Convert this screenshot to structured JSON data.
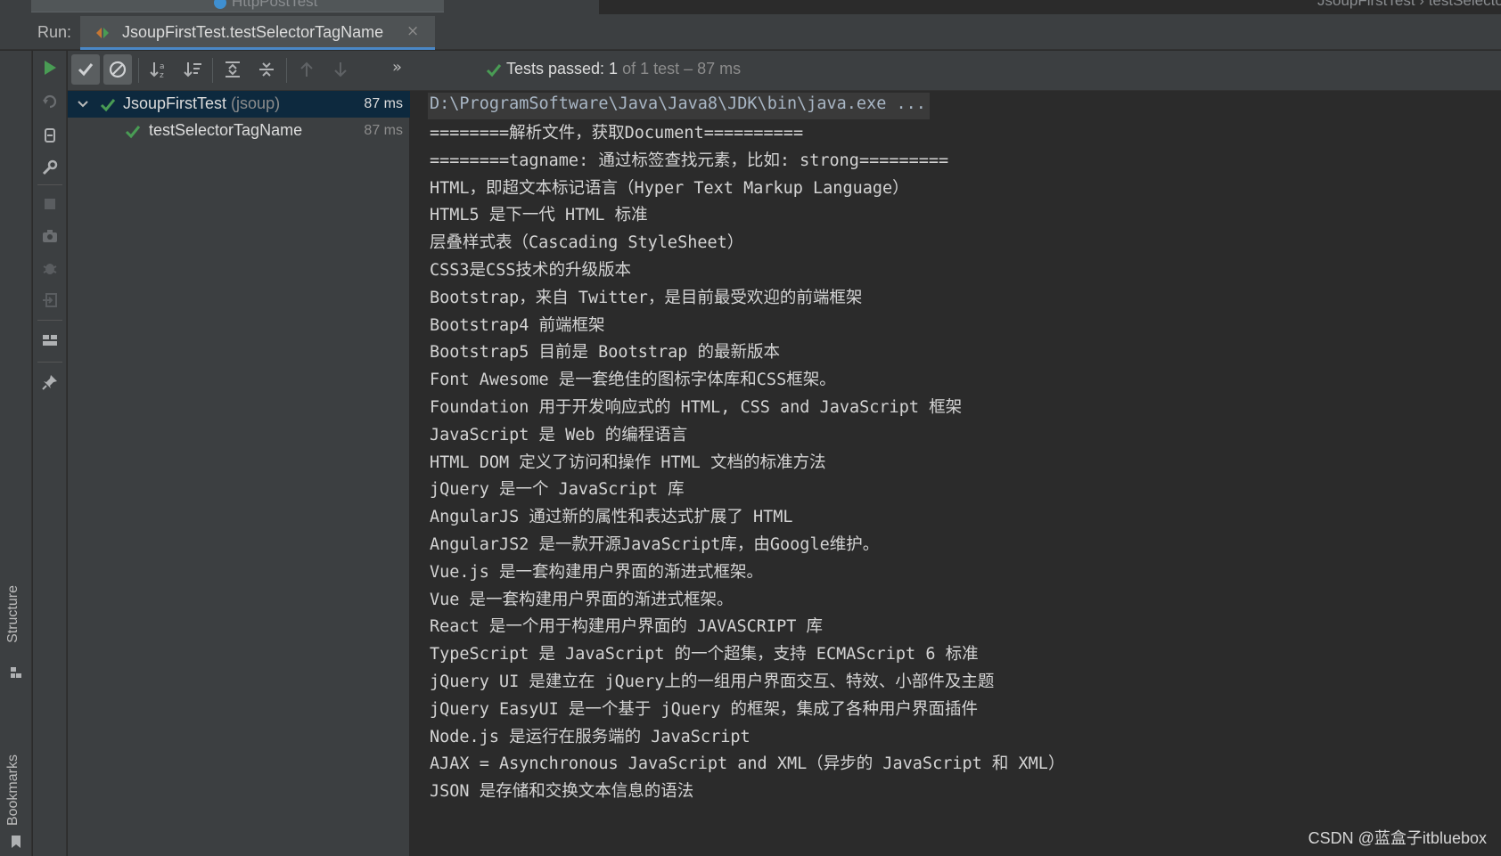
{
  "top_strip": {
    "left_tab": "HttpPostTest",
    "breadcrumb": "JsoupFirstTest  ›  testSelectorTagName()"
  },
  "run_bar": {
    "label": "Run:",
    "tab_title": "JsoupFirstTest.testSelectorTagName",
    "close_glyph": "×"
  },
  "toolbar": {
    "more_glyph": "»",
    "status_passed": "Tests passed: 1",
    "status_rest": " of 1 test – 87 ms"
  },
  "tree": {
    "root_name": "JsoupFirstTest",
    "root_pkg": " (jsoup)",
    "root_time": "87 ms",
    "child_name": "testSelectorTagName",
    "child_time": "87 ms"
  },
  "console": {
    "command": "D:\\ProgramSoftware\\Java\\Java8\\JDK\\bin\\java.exe ...",
    "lines": [
      "========解析文件，获取Document==========",
      "========tagname: 通过标签查找元素，比如: strong=========",
      "HTML，即超文本标记语言（Hyper Text Markup Language）",
      "HTML5 是下一代 HTML 标准",
      "层叠样式表（Cascading StyleSheet）",
      "CSS3是CSS技术的升级版本",
      "Bootstrap，来自 Twitter，是目前最受欢迎的前端框架",
      "Bootstrap4 前端框架",
      "Bootstrap5 目前是 Bootstrap 的最新版本",
      "Font Awesome 是一套绝佳的图标字体库和CSS框架。",
      "Foundation 用于开发响应式的 HTML, CSS and JavaScript 框架",
      "JavaScript 是 Web 的编程语言",
      "HTML DOM 定义了访问和操作 HTML 文档的标准方法",
      "jQuery 是一个 JavaScript 库",
      "AngularJS 通过新的属性和表达式扩展了 HTML",
      "AngularJS2 是一款开源JavaScript库，由Google维护。",
      "Vue.js 是一套构建用户界面的渐进式框架。",
      "Vue 是一套构建用户界面的渐进式框架。",
      "React 是一个用于构建用户界面的 JAVASCRIPT 库",
      "TypeScript 是 JavaScript 的一个超集，支持 ECMAScript 6 标准",
      "jQuery UI 是建立在 jQuery上的一组用户界面交互、特效、小部件及主题",
      "jQuery EasyUI 是一个基于 jQuery 的框架，集成了各种用户界面插件",
      "Node.js 是运行在服务端的 JavaScript",
      "AJAX = Asynchronous JavaScript and XML（异步的 JavaScript 和 XML）",
      "JSON 是存储和交换文本信息的语法"
    ]
  },
  "side_tabs": {
    "structure": "Structure",
    "bookmarks": "Bookmarks"
  },
  "watermark": "CSDN @蓝盒子itbluebox",
  "colors": {
    "pass_green": "#499c54",
    "selection": "#0d293e",
    "panel": "#3c3f41",
    "console_bg": "#2b2b2b",
    "tab_underline": "#4a88c7"
  },
  "icons": {
    "run": "play-icon",
    "show_passed": "check-icon",
    "show_ignored": "ignored-icon",
    "sort_alpha": "sort-alphabetically-icon",
    "sort_duration": "sort-duration-icon",
    "expand_all": "expand-all-icon",
    "collapse_all": "collapse-all-icon",
    "prev_failed": "arrow-up-icon",
    "next_failed": "arrow-down-icon"
  }
}
